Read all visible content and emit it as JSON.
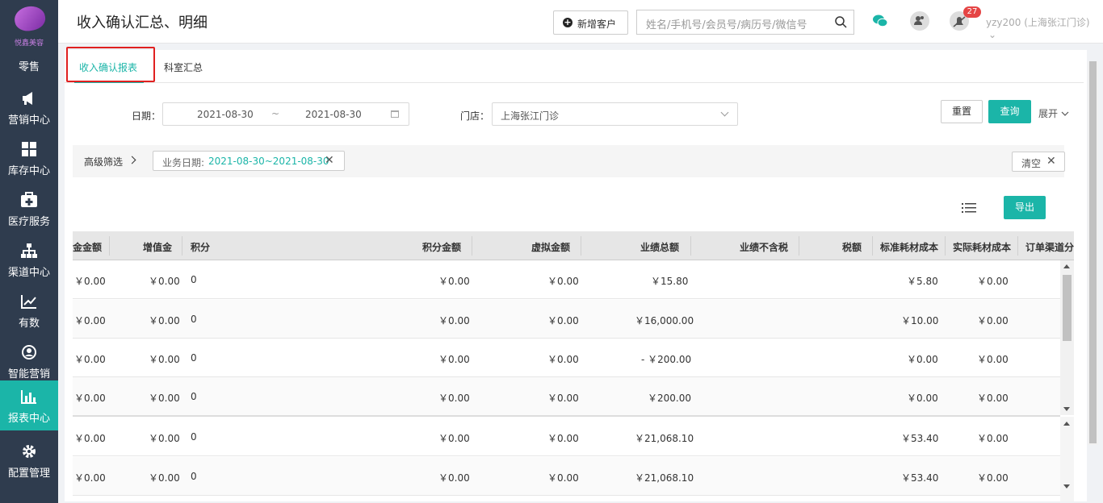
{
  "sidebar": {
    "logo_text": "悦鑫美容",
    "items": [
      {
        "label": "零售",
        "icon": "retail-icon"
      },
      {
        "label": "营销中心",
        "icon": "megaphone-icon"
      },
      {
        "label": "库存中心",
        "icon": "grid-icon"
      },
      {
        "label": "医疗服务",
        "icon": "medical-kit-icon"
      },
      {
        "label": "渠道中心",
        "icon": "org-chart-icon"
      },
      {
        "label": "有数",
        "icon": "line-chart-icon"
      },
      {
        "label": "智能营销",
        "icon": "smart-marketing-icon"
      },
      {
        "label": "报表中心",
        "icon": "bar-chart-icon",
        "active": true
      },
      {
        "label": "配置管理",
        "icon": "gear-icon"
      }
    ]
  },
  "header": {
    "title": "收入确认汇总、明细",
    "new_customer_label": "新增客户",
    "search_placeholder": "姓名/手机号/会员号/病历号/微信号",
    "notification_count": "27",
    "user": "yzy200 (上海张江门诊)"
  },
  "tabs": [
    {
      "label": "收入确认报表",
      "active": true
    },
    {
      "label": "科室汇总",
      "active": false
    }
  ],
  "filters": {
    "date_label": "日期：",
    "date_start": "2021-08-30",
    "date_sep": "~",
    "date_end": "2021-08-30",
    "store_label": "门店：",
    "store_value": "上海张江门诊",
    "reset_label": "重置",
    "query_label": "查询",
    "expand_label": "展开"
  },
  "advanced": {
    "label": "高级筛选",
    "chip_key": "业务日期: ",
    "chip_value": "2021-08-30~2021-08-30",
    "clear_label": "清空"
  },
  "export_label": "导出",
  "table": {
    "headers": [
      "金金额",
      "增值金",
      "积分",
      "积分金额",
      "虚拟金额",
      "业绩总额",
      "业绩不含税",
      "税额",
      "标准耗材成本",
      "实际耗材成本",
      "订单渠道分"
    ],
    "rows": [
      [
        "￥0.00",
        "￥0.00",
        "0",
        "￥0.00",
        "￥0.00",
        "￥15.80",
        "",
        "",
        "￥5.80",
        "￥0.00",
        ""
      ],
      [
        "￥0.00",
        "￥0.00",
        "0",
        "￥0.00",
        "￥0.00",
        "￥16,000.00",
        "",
        "",
        "￥10.00",
        "￥0.00",
        ""
      ],
      [
        "￥0.00",
        "￥0.00",
        "0",
        "￥0.00",
        "￥0.00",
        "- ￥200.00",
        "",
        "",
        "￥0.00",
        "￥0.00",
        ""
      ],
      [
        "￥0.00",
        "￥0.00",
        "0",
        "￥0.00",
        "￥0.00",
        "￥200.00",
        "",
        "",
        "￥0.00",
        "￥0.00",
        ""
      ],
      [
        "￥0.00",
        "￥0.00",
        "0",
        "￥0.00",
        "￥0.00",
        "￥21,068.10",
        "",
        "",
        "￥53.40",
        "￥0.00",
        ""
      ],
      [
        "￥0.00",
        "￥0.00",
        "0",
        "￥0.00",
        "￥0.00",
        "￥21,068.10",
        "",
        "",
        "￥53.40",
        "￥0.00",
        ""
      ]
    ]
  },
  "colors": {
    "sidebar": "#2f3c4e",
    "accent": "#1bb5a8",
    "badge": "#e54545",
    "highlight_box": "#e02020"
  }
}
